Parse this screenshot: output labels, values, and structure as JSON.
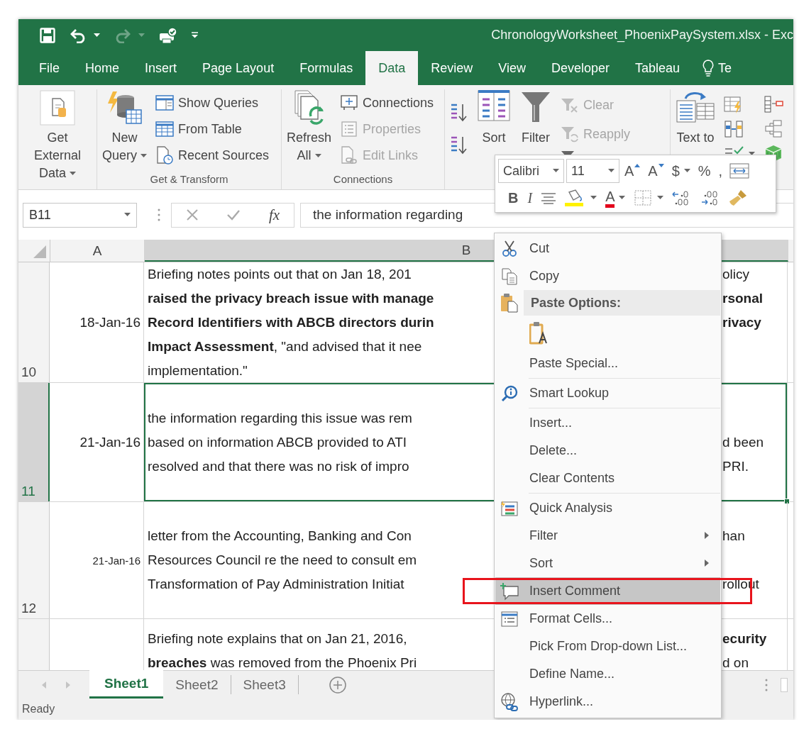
{
  "window": {
    "title": "ChronologyWorksheet_PhoenixPaySystem.xlsx - Exc"
  },
  "quick_access": [
    {
      "disabled": false,
      "dropdown": false
    },
    {
      "disabled": false,
      "dropdown": true
    },
    {
      "disabled": true,
      "dropdown": true
    },
    {
      "disabled": false,
      "dropdown": false
    },
    {
      "disabled": false,
      "dropdown": false
    }
  ],
  "tabs": [
    {
      "label": "File",
      "selected": false
    },
    {
      "label": "Home",
      "selected": false
    },
    {
      "label": "Insert",
      "selected": false
    },
    {
      "label": "Page Layout",
      "selected": false
    },
    {
      "label": "Formulas",
      "selected": false
    },
    {
      "label": "Data",
      "selected": true
    },
    {
      "label": "Review",
      "selected": false
    },
    {
      "label": "View",
      "selected": false
    },
    {
      "label": "Developer",
      "selected": false
    },
    {
      "label": "Tableau",
      "selected": false
    }
  ],
  "tell_me": {
    "label": "Te"
  },
  "ribbon": {
    "groups": [
      {
        "buttons": [
          {
            "label": "Get External\nData",
            "kind": "large",
            "dropdown": true,
            "disabled": false
          }
        ]
      },
      {
        "label": "Get & Transform",
        "buttons": [
          {
            "label": "New\nQuery",
            "kind": "large",
            "dropdown": true,
            "disabled": false
          },
          {
            "label": "Show Queries",
            "kind": "small",
            "dropdown": false,
            "disabled": false
          },
          {
            "label": "From Table",
            "kind": "small",
            "dropdown": false,
            "disabled": false
          },
          {
            "label": "Recent Sources",
            "kind": "small",
            "dropdown": false,
            "disabled": false
          }
        ]
      },
      {
        "label": "Connections",
        "buttons": [
          {
            "label": "Refresh\nAll",
            "kind": "large",
            "dropdown": true,
            "disabled": false
          },
          {
            "label": "Connections",
            "kind": "small",
            "dropdown": false,
            "disabled": false
          },
          {
            "label": "Properties",
            "kind": "small",
            "dropdown": false,
            "disabled": true
          },
          {
            "label": "Edit Links",
            "kind": "small",
            "dropdown": false,
            "disabled": true
          }
        ]
      },
      {
        "buttons": [
          {
            "kind": "icon",
            "dropdown": false,
            "disabled": false
          },
          {
            "kind": "icon",
            "dropdown": false,
            "disabled": false
          },
          {
            "label": "Sort",
            "kind": "large",
            "dropdown": false,
            "disabled": false
          },
          {
            "label": "Filter",
            "kind": "large",
            "dropdown": false,
            "disabled": false
          },
          {
            "label": "Clear",
            "kind": "small",
            "dropdown": false,
            "disabled": true
          },
          {
            "label": "Reapply",
            "kind": "small",
            "dropdown": false,
            "disabled": true
          },
          {
            "kind": "icon",
            "dropdown": false,
            "disabled": false
          }
        ]
      },
      {
        "buttons": [
          {
            "label": "Text to",
            "kind": "large",
            "dropdown": false,
            "disabled": false
          },
          {
            "kind": "icon",
            "dropdown": false,
            "disabled": false
          },
          {
            "kind": "icon",
            "dropdown": false,
            "disabled": false
          },
          {
            "kind": "icon",
            "dropdown": true,
            "disabled": false
          },
          {
            "kind": "icon",
            "dropdown": false,
            "disabled": false
          },
          {
            "kind": "icon",
            "dropdown": false,
            "disabled": false
          },
          {
            "kind": "icon",
            "dropdown": false,
            "disabled": false
          }
        ]
      }
    ]
  },
  "mini_toolbar": {
    "font": "Calibri",
    "size": "11",
    "row_1": [
      {
        "label": "A",
        "dropdown": false
      },
      {
        "label": "A",
        "dropdown": false
      },
      {
        "label": "$",
        "dropdown": true
      },
      {
        "label": "%",
        "dropdown": false
      },
      {
        "label": ",",
        "dropdown": false
      },
      {
        "dropdown": false
      }
    ],
    "row_2": [
      {
        "label": "B",
        "dropdown": false
      },
      {
        "label": "I",
        "dropdown": false
      },
      {
        "dropdown": false
      },
      {
        "dropdown": true
      },
      {
        "label": "A",
        "dropdown": true
      },
      {
        "dropdown": true
      },
      {
        "dropdown": false
      },
      {
        "dropdown": false
      },
      {
        "dropdown": false
      }
    ]
  },
  "formula_bar": {
    "name_box": "B11",
    "function_label": "fx",
    "content": "the information regarding"
  },
  "columns": [
    {
      "label": "A",
      "selected": false
    },
    {
      "label": "B",
      "selected": true
    }
  ],
  "rows": [
    {
      "row": "10",
      "date": "18-Jan-16",
      "kind": "normal",
      "selected": false,
      "lines": [
        {
          "left": "Briefing notes points out that on Jan 18, 201",
          "right": "olicy",
          "left_bold": false,
          "right_bold": false
        },
        {
          "left": "raised the privacy breach issue with manage",
          "right": "rsonal",
          "left_bold": true,
          "right_bold": true
        },
        {
          "left": "Record Identifiers with ABCB directors durin",
          "right": "rivacy",
          "left_bold": true,
          "right_bold": true
        },
        {
          "left": "**Impact Assessment**, \"and advised that it nee",
          "left_bold": false
        },
        {
          "left": "implementation.\"",
          "left_bold": false
        }
      ]
    },
    {
      "row": "11",
      "date": "21-Jan-16",
      "kind": "normal",
      "selected": true,
      "lines": [
        {
          "left": "the information regarding this issue was rem",
          "left_bold": false
        },
        {
          "left": "based on information ABCB provided to ATI",
          "right": "d been",
          "left_bold": false,
          "right_bold": false
        },
        {
          "left": "resolved and that there was no risk of impro",
          "right": "PRI.",
          "left_bold": false,
          "right_bold": false
        }
      ]
    },
    {
      "row": "12",
      "date": "21-Jan-16",
      "kind": "compact",
      "selected": false,
      "lines": [
        {
          "left": "letter from the Accounting, Banking and Con",
          "right": "han",
          "left_bold": false,
          "right_bold": false
        },
        {
          "left": "Resources Council re the need to consult em",
          "left_bold": false
        },
        {
          "left": "Transformation of Pay Administration Initiat",
          "right": "rollout",
          "left_bold": false,
          "right_bold": false
        }
      ]
    },
    {
      "selected": false,
      "lines": [
        {
          "left": "Briefing note explains that on Jan 21, 2016,",
          "right": "ecurity",
          "left_bold": false,
          "right_bold": true
        },
        {
          "left": "**breaches** was removed from the Phoenix Pri",
          "right": "d on",
          "left_bold": false,
          "right_bold": false
        }
      ]
    }
  ],
  "context_menu": [
    {
      "kind": "item",
      "label": "Cut",
      "submenu": false,
      "selected": false
    },
    {
      "kind": "item",
      "label": "Copy",
      "submenu": false,
      "selected": false
    },
    {
      "kind": "header",
      "label": "Paste Options:"
    },
    {
      "kind": "paste_option",
      "selected": false
    },
    {
      "kind": "item",
      "label": "Paste Special...",
      "submenu": false,
      "selected": false
    },
    {
      "kind": "separator"
    },
    {
      "kind": "item",
      "label": "Smart Lookup",
      "submenu": false,
      "selected": false
    },
    {
      "kind": "separator"
    },
    {
      "kind": "item",
      "label": "Insert...",
      "submenu": false,
      "selected": false
    },
    {
      "kind": "item",
      "label": "Delete...",
      "submenu": false,
      "selected": false
    },
    {
      "kind": "item",
      "label": "Clear Contents",
      "submenu": false,
      "selected": false
    },
    {
      "kind": "separator"
    },
    {
      "kind": "item",
      "label": "Quick Analysis",
      "submenu": false,
      "selected": false
    },
    {
      "kind": "item",
      "label": "Filter",
      "submenu": true,
      "selected": false
    },
    {
      "kind": "item",
      "label": "Sort",
      "submenu": true,
      "selected": false
    },
    {
      "kind": "item",
      "label": "Insert Comment",
      "submenu": false,
      "selected": true
    },
    {
      "kind": "item",
      "label": "Format Cells...",
      "submenu": false,
      "selected": false
    },
    {
      "kind": "item",
      "label": "Pick From Drop-down List...",
      "submenu": false,
      "selected": false
    },
    {
      "kind": "item",
      "label": "Define Name...",
      "submenu": false,
      "selected": false
    },
    {
      "kind": "item",
      "label": "Hyperlink...",
      "submenu": false,
      "selected": false
    }
  ],
  "sheets": [
    {
      "label": "Sheet1",
      "selected": true
    },
    {
      "label": "Sheet2",
      "selected": false
    },
    {
      "label": "Sheet3",
      "selected": false
    }
  ],
  "status_bar": {
    "text": "Ready"
  }
}
